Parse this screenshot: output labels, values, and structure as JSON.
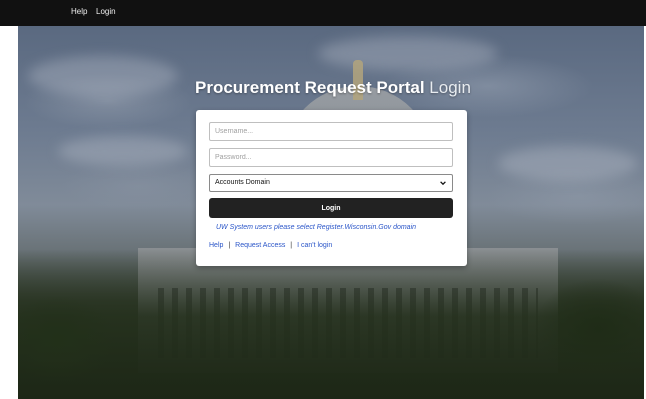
{
  "topbar": {
    "help_label": "Help",
    "login_label": "Login"
  },
  "title": {
    "bold": "Procurement Request Portal",
    "light": "Login"
  },
  "form": {
    "username_placeholder": "Username...",
    "password_placeholder": "Password...",
    "domain_selected": "Accounts Domain",
    "login_button": "Login",
    "note": "UW System users please select Register.Wisconsin.Gov domain"
  },
  "links": {
    "help": "Help",
    "request_access": "Request Access",
    "cant_login": "I can't login",
    "separator": "|"
  },
  "colors": {
    "topbar": "#111111",
    "button": "#222222",
    "link": "#2a55c8"
  },
  "icons": {
    "select_chevron": "chevron-down-icon"
  }
}
